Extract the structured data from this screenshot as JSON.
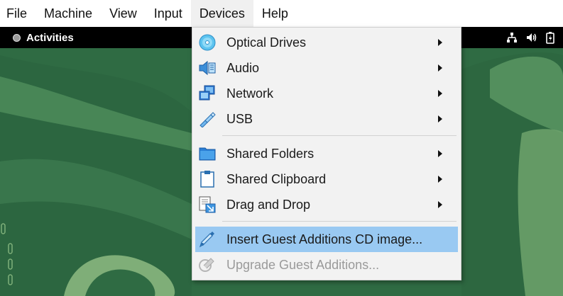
{
  "menubar": {
    "items": [
      {
        "label": "File"
      },
      {
        "label": "Machine"
      },
      {
        "label": "View"
      },
      {
        "label": "Input"
      },
      {
        "label": "Devices",
        "active": true
      },
      {
        "label": "Help"
      }
    ]
  },
  "guest_topbar": {
    "activities_label": "Activities",
    "tray_icons": [
      "network-icon",
      "volume-icon",
      "battery-icon"
    ]
  },
  "devices_menu": {
    "groups": [
      [
        {
          "label": "Optical Drives",
          "icon": "optical-drive-icon",
          "submenu": true
        },
        {
          "label": "Audio",
          "icon": "audio-icon",
          "submenu": true
        },
        {
          "label": "Network",
          "icon": "network-adapter-icon",
          "submenu": true
        },
        {
          "label": "USB",
          "icon": "usb-icon",
          "submenu": true
        }
      ],
      [
        {
          "label": "Shared Folders",
          "icon": "shared-folder-icon",
          "submenu": true
        },
        {
          "label": "Shared Clipboard",
          "icon": "clipboard-icon",
          "submenu": true
        },
        {
          "label": "Drag and Drop",
          "icon": "drag-drop-icon",
          "submenu": true
        }
      ],
      [
        {
          "label": "Insert Guest Additions CD image...",
          "icon": "insert-cd-icon",
          "highlighted": true
        },
        {
          "label": "Upgrade Guest Additions...",
          "icon": "upgrade-icon",
          "disabled": true
        }
      ]
    ]
  },
  "colors": {
    "highlight": "#99c9f2",
    "desktop_green": "#2e6841",
    "topbar": "#000000"
  }
}
